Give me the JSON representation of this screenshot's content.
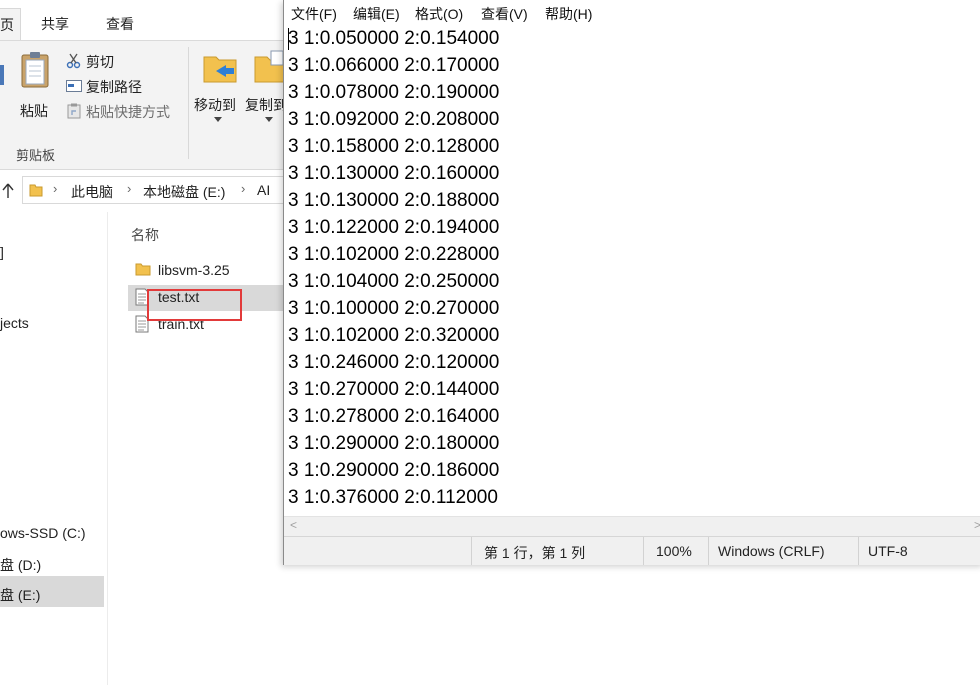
{
  "explorer": {
    "tabs": {
      "home_partial": "页",
      "share": "共享",
      "view": "查看"
    },
    "ribbon": {
      "paste": "粘贴",
      "cut": "剪切",
      "copy_path": "复制路径",
      "paste_shortcut": "粘贴快捷方式",
      "clipboard_group": "剪贴板",
      "move_to": "移动到",
      "copy_to": "复制到"
    },
    "breadcrumb": [
      "此电脑",
      "本地磁盘 (E:)",
      "AI"
    ],
    "nav_items": [
      "]",
      "jects",
      "ows-SSD (C:)",
      "盘 (D:)",
      "盘 (E:)"
    ],
    "column_header": "名称",
    "files": [
      {
        "name": "libsvm-3.25",
        "type": "folder"
      },
      {
        "name": "test.txt",
        "type": "text"
      },
      {
        "name": "train.txt",
        "type": "text"
      }
    ]
  },
  "notepad": {
    "menu": [
      "文件(F)",
      "编辑(E)",
      "格式(O)",
      "查看(V)",
      "帮助(H)"
    ],
    "lines": [
      "3 1:0.050000 2:0.154000",
      "3 1:0.066000 2:0.170000",
      "3 1:0.078000 2:0.190000",
      "3 1:0.092000 2:0.208000",
      "3 1:0.158000 2:0.128000",
      "3 1:0.130000 2:0.160000",
      "3 1:0.130000 2:0.188000",
      "3 1:0.122000 2:0.194000",
      "3 1:0.102000 2:0.228000",
      "3 1:0.104000 2:0.250000",
      "3 1:0.100000 2:0.270000",
      "3 1:0.102000 2:0.320000",
      "3 1:0.246000 2:0.120000",
      "3 1:0.270000 2:0.144000",
      "3 1:0.278000 2:0.164000",
      "3 1:0.290000 2:0.180000",
      "3 1:0.290000 2:0.186000",
      "3 1:0.376000 2:0.112000"
    ],
    "status": {
      "position": "第 1 行，第 1 列",
      "zoom": "100%",
      "line_ending": "Windows (CRLF)",
      "encoding": "UTF-8"
    }
  },
  "colors": {
    "annotation_box": "#e23a3a",
    "selection": "#d9d9d9",
    "folder": "#f2c14e"
  }
}
